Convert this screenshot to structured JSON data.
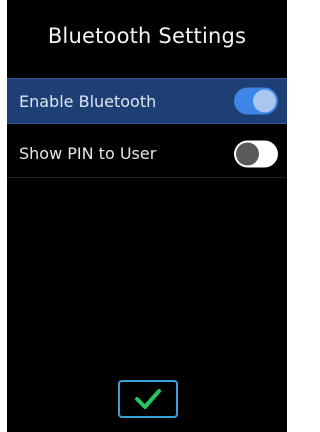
{
  "header": {
    "title": "Bluetooth Settings"
  },
  "settings": [
    {
      "label": "Enable Bluetooth",
      "enabled": true,
      "selected": true
    },
    {
      "label": "Show PIN to User",
      "enabled": false,
      "selected": false
    }
  ],
  "footer": {
    "confirm_icon": "checkmark-icon"
  },
  "colors": {
    "background": "#000000",
    "selected_row": "#1e3f74",
    "toggle_on": "#3d85e6",
    "toggle_off": "#ffffff",
    "confirm_border": "#3aa1d4",
    "check": "#22c55e"
  }
}
